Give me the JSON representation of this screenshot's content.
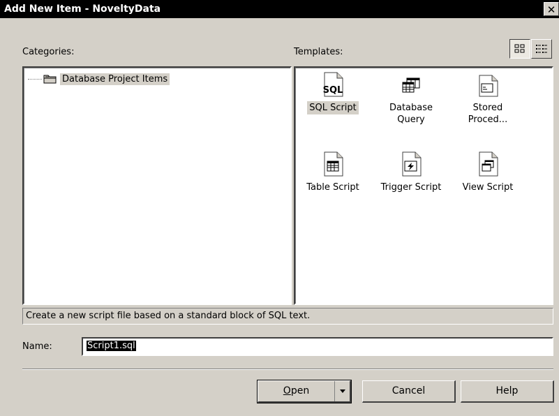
{
  "window": {
    "title": "Add New Item - NoveltyData",
    "close_glyph": "✕"
  },
  "categories": {
    "label": "Categories:",
    "items": [
      {
        "label": "Database Project Items",
        "icon": "folder-icon"
      }
    ]
  },
  "templates": {
    "label": "Templates:",
    "items": [
      {
        "label": "SQL Script",
        "icon": "sql-script-icon",
        "selected": true
      },
      {
        "label": "Database Query",
        "icon": "database-query-icon"
      },
      {
        "label": "Stored Proced...",
        "icon": "stored-procedure-icon"
      },
      {
        "label": "Table Script",
        "icon": "table-script-icon"
      },
      {
        "label": "Trigger Script",
        "icon": "trigger-script-icon"
      },
      {
        "label": "View Script",
        "icon": "view-script-icon"
      }
    ],
    "sql_icon_text": "SQL"
  },
  "view_buttons": [
    {
      "name": "large-icons",
      "pressed": true
    },
    {
      "name": "small-icons",
      "pressed": false
    }
  ],
  "description": "Create a new script file based on a standard block of SQL text.",
  "name_field": {
    "label": "Name:",
    "value": "Script1.sql"
  },
  "buttons": {
    "open_prefix": "O",
    "open_rest": "pen",
    "cancel": "Cancel",
    "help": "Help"
  },
  "colors": {
    "title_bar": "#000000",
    "face": "#d4d0c8",
    "selection": "#000000"
  }
}
